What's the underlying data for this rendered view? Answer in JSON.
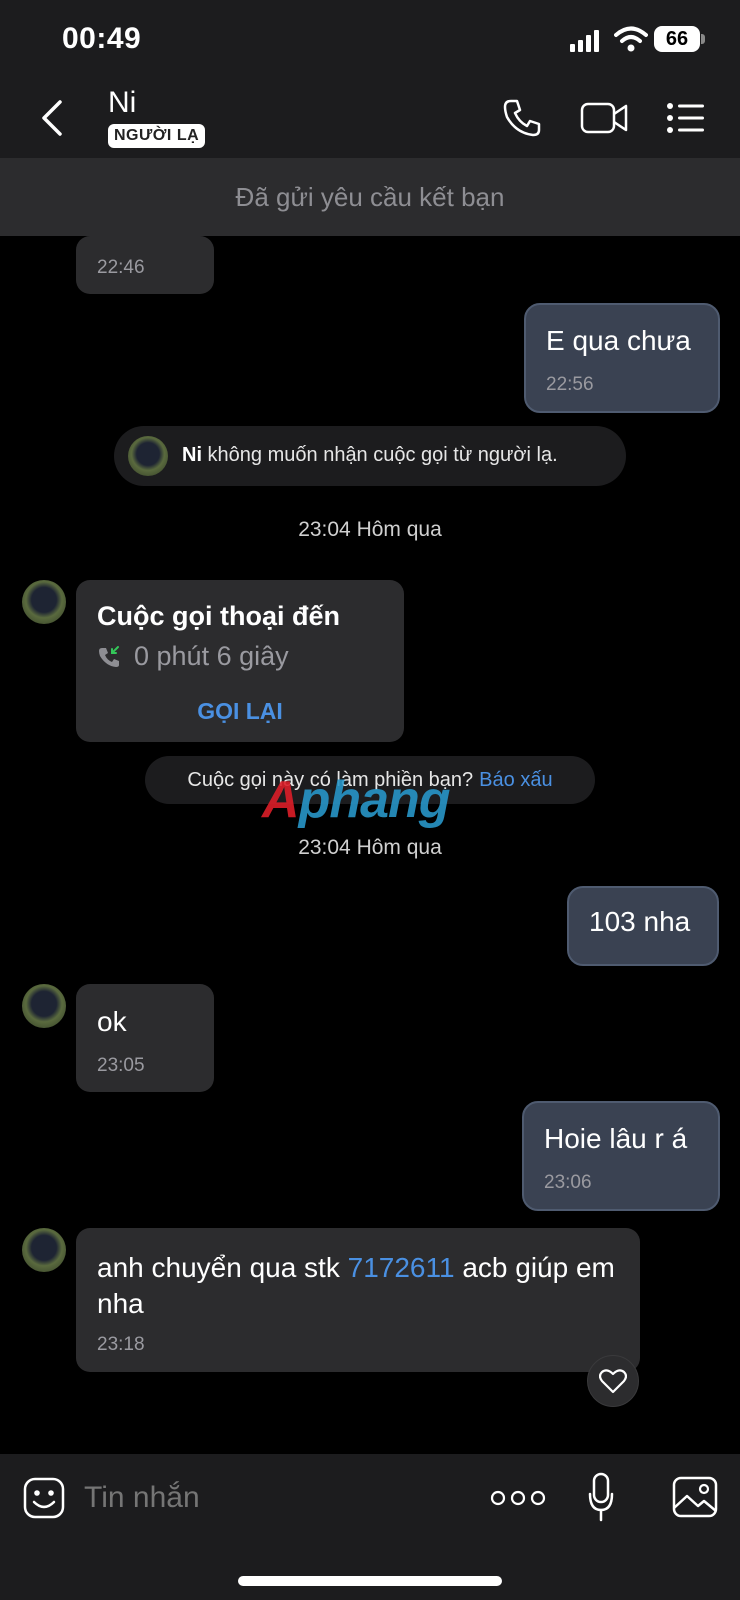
{
  "status_bar": {
    "time": "00:49",
    "battery": "66"
  },
  "header": {
    "contact_name": "Ni",
    "badge": "NGƯỜI LẠ"
  },
  "friend_banner": "Đã gửi yêu cầu kết bạn",
  "messages": {
    "m0_time": "22:46",
    "m1_text": "E qua chưa",
    "m1_time": "22:56",
    "system_name": "Ni",
    "system_text": " không muốn nhận cuộc gọi từ người lạ.",
    "ts1": "23:04 Hôm qua",
    "call_title": "Cuộc gọi thoại đến",
    "call_duration": "0 phút 6 giây",
    "call_back": "GỌI LẠI",
    "report_text": "Cuộc gọi này có làm phiền bạn?",
    "report_link": "Báo xấu",
    "ts2": "23:04 Hôm qua",
    "m2_text": "103 nha",
    "m3_text": "ok",
    "m3_time": "23:05",
    "m4_text": "Hoie lâu r á",
    "m4_time": "23:06",
    "m5_pre": " anh chuyển qua stk ",
    "m5_link": "7172611",
    "m5_post": " acb giúp em nha",
    "m5_time": "23:18"
  },
  "watermark": {
    "part1": "A",
    "part2": "phang"
  },
  "input": {
    "placeholder": "Tin nhắn"
  },
  "colors": {
    "link": "#4a90e2",
    "outgoing_bubble": "#3a4252",
    "incoming_bubble": "#2c2c2e"
  }
}
